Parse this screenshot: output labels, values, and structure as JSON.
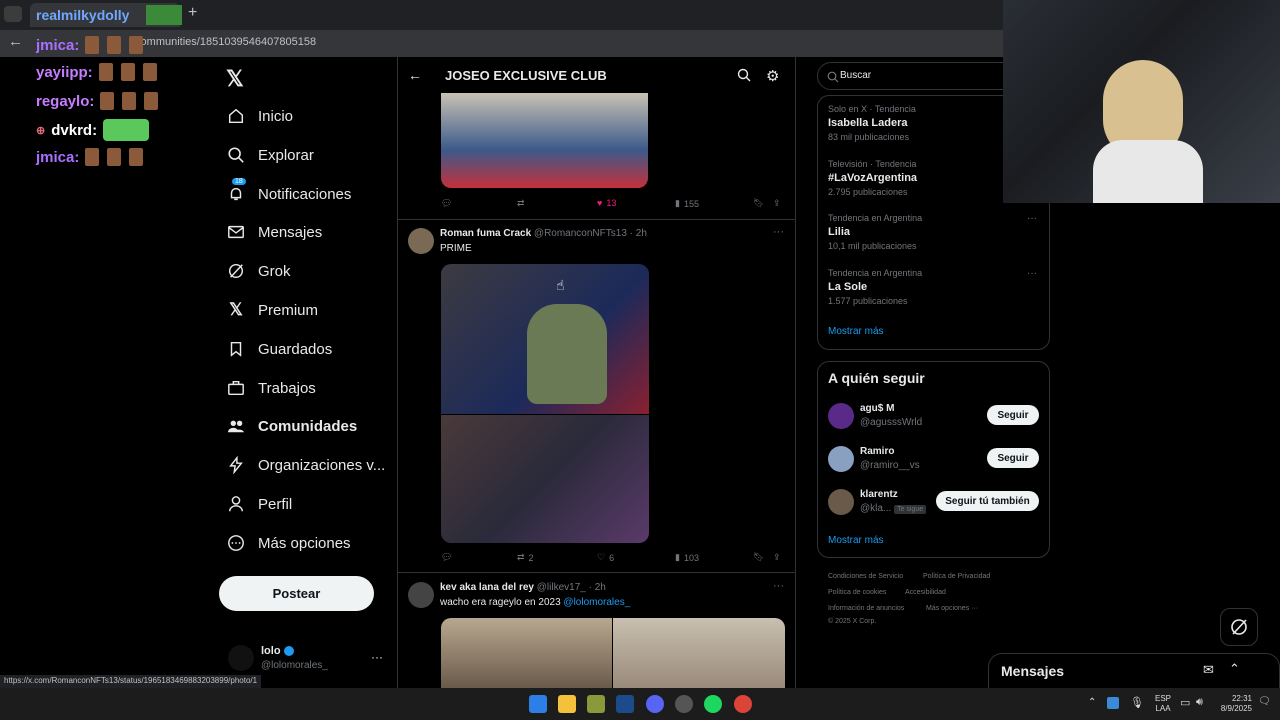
{
  "browser": {
    "tab_title": "realmilkydolly",
    "url": "/communities/1851039546407805158",
    "status_url": "https://x.com/RomanconNFTs13/status/1965183469883203899/photo/1"
  },
  "overlay_chat": [
    {
      "user": "jmica:",
      "color": "#a970ff"
    },
    {
      "user": "yayiipp:",
      "color": "#c77dff"
    },
    {
      "user": "regaylo:",
      "color": "#c77dff"
    },
    {
      "user": "dvkrd:",
      "color": "#ffffff"
    },
    {
      "user": "jmica:",
      "color": "#a970ff"
    }
  ],
  "nav": {
    "items": [
      {
        "label": "Inicio"
      },
      {
        "label": "Explorar"
      },
      {
        "label": "Notificaciones"
      },
      {
        "label": "Mensajes"
      },
      {
        "label": "Grok"
      },
      {
        "label": "Premium"
      },
      {
        "label": "Guardados"
      },
      {
        "label": "Trabajos"
      },
      {
        "label": "Comunidades"
      },
      {
        "label": "Organizaciones v..."
      },
      {
        "label": "Perfil"
      },
      {
        "label": "Más opciones"
      }
    ],
    "notif_badge": "18",
    "post_label": "Postear",
    "account": {
      "name": "lolo",
      "handle": "@lolomorales_"
    }
  },
  "community": {
    "title": "JOSEO EXCLUSIVE CLUB"
  },
  "tweets": [
    {
      "likes": "13",
      "views": "155"
    },
    {
      "name": "Roman fuma Crack",
      "handle": "@RomanconNFTs13 · 2h",
      "text": "PRIME",
      "retweets": "2",
      "likes": "6",
      "views": "103"
    },
    {
      "name": "kev aka lana del rey",
      "handle": "@lilkev17_ · 2h",
      "text": "wacho era rageylo en 2023 ",
      "mention": "@lolomorales_"
    }
  ],
  "search": {
    "placeholder": "Buscar"
  },
  "trends": [
    {
      "meta": "Solo en X · Tendencia",
      "name": "Isabella Ladera",
      "count": "83 mil publicaciones"
    },
    {
      "meta": "Televisión · Tendencia",
      "name": "#LaVozArgentina",
      "count": "2.795 publicaciones"
    },
    {
      "meta": "Tendencia en Argentina",
      "name": "Lilia",
      "count": "10,1 mil publicaciones"
    },
    {
      "meta": "Tendencia en Argentina",
      "name": "La Sole",
      "count": "1.577 publicaciones"
    }
  ],
  "show_more": "Mostrar más",
  "who_to_follow": {
    "title": "A quién seguir",
    "users": [
      {
        "name": "agu$ M",
        "handle": "@agusssWrld",
        "button": "Seguir"
      },
      {
        "name": "Ramiro",
        "handle": "@ramiro__vs",
        "button": "Seguir"
      },
      {
        "name": "klarentz",
        "handle": "@kla...",
        "badge": "Te sigue",
        "button": "Seguir tú también"
      }
    ],
    "show_more": "Mostrar más"
  },
  "footer": {
    "links": [
      "Condiciones de Servicio",
      "Política de Privacidad",
      "Política de cookies",
      "Accesibilidad",
      "Información de anuncios",
      "Más opciones ···"
    ],
    "copyright": "© 2025 X Corp."
  },
  "messages_label": "Mensajes",
  "taskbar": {
    "lang": "ESP",
    "lang2": "LAA",
    "time": "22:31",
    "date": "8/9/2025"
  },
  "colors": {
    "accent": "#1d9bf0",
    "like": "#f91880",
    "bg": "#000000"
  }
}
